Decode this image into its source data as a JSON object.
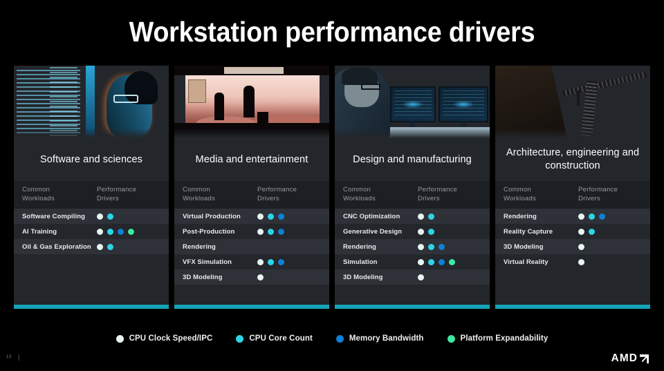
{
  "slide": {
    "title": "Workstation performance drivers",
    "page_number": "13",
    "separator": "|",
    "brand": "AMD",
    "accent_color": "#14a3b8"
  },
  "table_headers": {
    "col1": "Common\nWorkloads",
    "col2": "Performance\nDrivers"
  },
  "driver_colors": {
    "cpu_clock": "#e8f4f2",
    "core_count": "#2dd4e8",
    "memory_bandwidth": "#0f7fd4",
    "platform_expandability": "#3ee8a0"
  },
  "cards": [
    {
      "title": "Software and sciences",
      "photo": "developer-at-code-screens-photo",
      "rows": [
        {
          "label": "Software Compiling",
          "drivers": [
            "cpu_clock",
            "core_count"
          ]
        },
        {
          "label": "AI Training",
          "drivers": [
            "cpu_clock",
            "core_count",
            "memory_bandwidth",
            "platform_expandability"
          ]
        },
        {
          "label": "Oil & Gas Exploration",
          "drivers": [
            "cpu_clock",
            "core_count"
          ]
        }
      ]
    },
    {
      "title": "Media and entertainment",
      "photo": "led-volume-stage-photo",
      "rows": [
        {
          "label": "Virtual Production",
          "drivers": [
            "cpu_clock",
            "core_count",
            "memory_bandwidth"
          ]
        },
        {
          "label": "Post-Production",
          "drivers": [
            "cpu_clock",
            "core_count",
            "memory_bandwidth"
          ]
        },
        {
          "label": "Rendering",
          "drivers": []
        },
        {
          "label": "VFX Simulation",
          "drivers": [
            "cpu_clock",
            "core_count",
            "memory_bandwidth"
          ]
        },
        {
          "label": "3D Modeling",
          "drivers": [
            "cpu_clock"
          ]
        }
      ]
    },
    {
      "title": "Design and manufacturing",
      "photo": "cad-engineer-dual-monitors-photo",
      "rows": [
        {
          "label": "CNC Optimization",
          "drivers": [
            "cpu_clock",
            "core_count"
          ]
        },
        {
          "label": "Generative Design",
          "drivers": [
            "cpu_clock",
            "core_count"
          ]
        },
        {
          "label": "Rendering",
          "drivers": [
            "cpu_clock",
            "core_count",
            "memory_bandwidth"
          ]
        },
        {
          "label": "Simulation",
          "drivers": [
            "cpu_clock",
            "core_count",
            "memory_bandwidth",
            "platform_expandability"
          ]
        },
        {
          "label": "3D Modeling",
          "drivers": [
            "cpu_clock"
          ]
        }
      ]
    },
    {
      "title": "Architecture, engineering and construction",
      "photo": "construction-crane-photo",
      "rows": [
        {
          "label": "Rendering",
          "drivers": [
            "cpu_clock",
            "core_count",
            "memory_bandwidth"
          ]
        },
        {
          "label": "Reality Capture",
          "drivers": [
            "cpu_clock",
            "core_count"
          ]
        },
        {
          "label": "3D Modeling",
          "drivers": [
            "cpu_clock"
          ]
        },
        {
          "label": "Virtual Reality",
          "drivers": [
            "cpu_clock"
          ]
        }
      ]
    }
  ],
  "legend": [
    {
      "label": "CPU Clock Speed/IPC",
      "color_key": "cpu_clock"
    },
    {
      "label": "CPU Core Count",
      "color_key": "core_count"
    },
    {
      "label": "Memory Bandwidth",
      "color_key": "memory_bandwidth"
    },
    {
      "label": "Platform Expandability",
      "color_key": "platform_expandability"
    }
  ]
}
